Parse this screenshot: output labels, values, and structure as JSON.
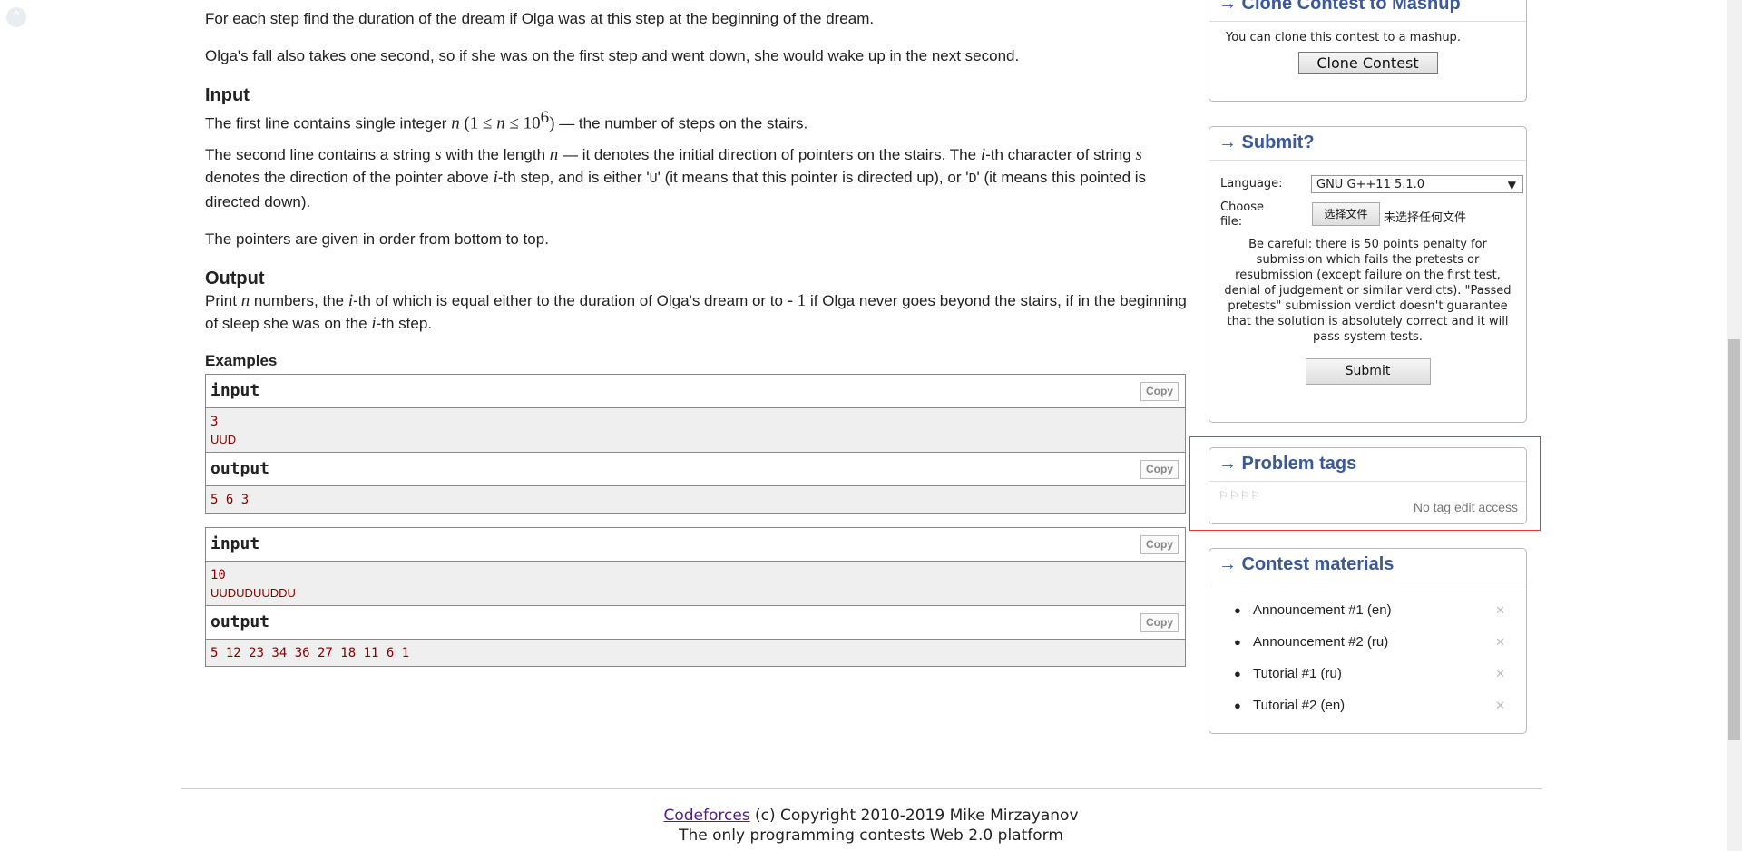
{
  "statement": {
    "intro1": "For each step find the duration of the dream if Olga was at this step at the beginning of the dream.",
    "intro2": "Olga's fall also takes one second, so if she was on the first step and went down, she would wake up in the next second.",
    "input_title": "Input",
    "input_p1_pre": "The first line contains single integer ",
    "input_p1_math": "n",
    "input_p1_paren_open": " (1 ≤ ",
    "input_p1_n2": "n",
    "input_p1_le": " ≤ 10",
    "input_p1_exp": "6",
    "input_p1_paren_close": ")",
    "input_p1_post": " — the number of steps on the stairs.",
    "input_p2_a": "The second line contains a string ",
    "input_p2_s": "s",
    "input_p2_b": " with the length ",
    "input_p2_n": "n",
    "input_p2_c": " — it denotes the initial direction of pointers on the stairs. The ",
    "input_p2_i": "i",
    "input_p2_d": "-th character of string ",
    "input_p2_s2": "s",
    "input_p2_e": " denotes the direction of the pointer above ",
    "input_p2_i2": "i",
    "input_p2_f": "-th step, and is either '",
    "input_p2_U": "U",
    "input_p2_g": "' (it means that this pointer is directed up), or '",
    "input_p2_D": "D",
    "input_p2_h": "' (it means this pointed is directed down).",
    "input_p3": "The pointers are given in order from bottom to top.",
    "output_title": "Output",
    "output_a": "Print ",
    "output_n": "n",
    "output_b": " numbers, the ",
    "output_i": "i",
    "output_c": "-th of which is equal either to the duration of Olga's dream or to ",
    "output_minus1": " - 1",
    "output_d": " if Olga never goes beyond the stairs, if in the beginning of sleep she was on the ",
    "output_i2": "i",
    "output_e": "-th step."
  },
  "examples": {
    "title": "Examples",
    "copy_label": "Copy",
    "input_label": "input",
    "output_label": "output",
    "ex1_in_line1": "3",
    "ex1_in_line2": "UUD",
    "ex1_out": "5 6 3",
    "ex2_in_line1": "10",
    "ex2_in_line2": "UUDUDUUDDU",
    "ex2_out": "5 12 23 34 36 27 18 11 6 1"
  },
  "sidebar": {
    "clone": {
      "title": "→ Clone Contest to Mashup",
      "text": "You can clone this contest to a mashup.",
      "button": "Clone Contest"
    },
    "submit": {
      "title": "→ Submit?",
      "language_label": "Language:",
      "language_value": "GNU G++11 5.1.0",
      "file_label_1": "Choose",
      "file_label_2": "file:",
      "file_button": "选择文件",
      "file_status": "未选择任何文件",
      "warning": "Be careful: there is 50 points penalty for submission which fails the pretests or resubmission (except failure on the first test, denial of judgement or similar verdicts). \"Passed pretests\" submission verdict doesn't guarantee that the solution is absolutely correct and it will pass system tests.",
      "button": "Submit"
    },
    "tags": {
      "title": "→ Problem tags",
      "no_access": "No tag edit access"
    },
    "materials": {
      "title": "→ Contest materials",
      "items": [
        {
          "label": "Announcement #1 (en)"
        },
        {
          "label": "Announcement #2 (ru)"
        },
        {
          "label": "Tutorial #1 (ru)"
        },
        {
          "label": "Tutorial #2 (en)"
        }
      ]
    }
  },
  "footer": {
    "link": "Codeforces",
    "copyright": " (c) Copyright 2010-2019 Mike Mirzayanov",
    "line2": "The only programming contests Web 2.0 platform"
  },
  "colors": {
    "accent": "#3b5998",
    "example_text": "#8b0000",
    "highlight": "#e53935"
  }
}
